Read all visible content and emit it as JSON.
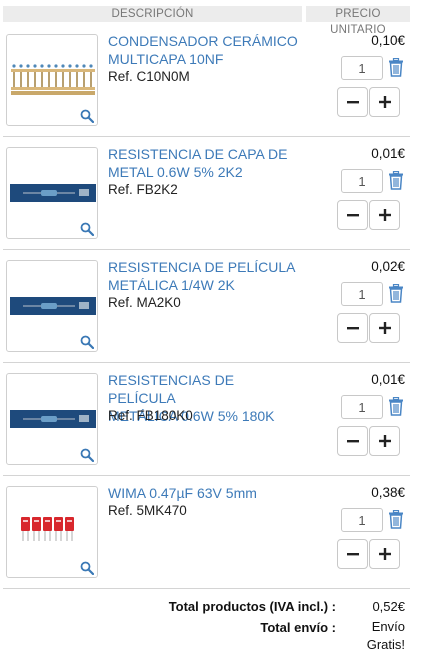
{
  "header": {
    "description": "DESCRIPCIÓN",
    "unit_price": "PRECIO UNITARIO"
  },
  "items": [
    {
      "title_line1": "CONDENSADOR CERÁMICO",
      "title_line2": "MULTICAPA 10nF",
      "ref": "Ref. C10N0M",
      "price": "0,10€",
      "qty": "1",
      "image": "ceramic-capacitor-strip"
    },
    {
      "title_line1": "RESISTENCIA DE CAPA DE",
      "title_line2": "METAL 0.6W 5% 2K2",
      "ref": "Ref. FB2K2",
      "price": "0,01€",
      "qty": "1",
      "image": "resistor-on-blue"
    },
    {
      "title_line1": "RESISTENCIA DE PELÍCULA",
      "title_line2": "METÁLICA 1/4W 2K",
      "ref": "Ref. MA2K0",
      "price": "0,02€",
      "qty": "1",
      "image": "resistor-on-blue"
    },
    {
      "title_line1": "RESISTENCIAS DE PELÍCULA",
      "title_line2": "METÁLICA 0.6W 5% 180K",
      "ref": "Ref. FB180K0",
      "price": "0,01€",
      "qty": "1",
      "image": "resistor-on-blue"
    },
    {
      "title_line1": "WIMA 0.47µF 63V 5mm",
      "title_line2": "",
      "ref": "Ref. 5MK470",
      "price": "0,38€",
      "qty": "1",
      "image": "red-film-capacitors"
    }
  ],
  "totals": {
    "products_label": "Total productos  (IVA incl.) :",
    "products_value": "0,52€",
    "shipping_label": "Total envío :",
    "shipping_value_line1": "Envío",
    "shipping_value_line2": "Gratis!"
  },
  "colors": {
    "link": "#3d7ab8",
    "trash": "#4a86c5",
    "header_bg": "#ececec"
  }
}
